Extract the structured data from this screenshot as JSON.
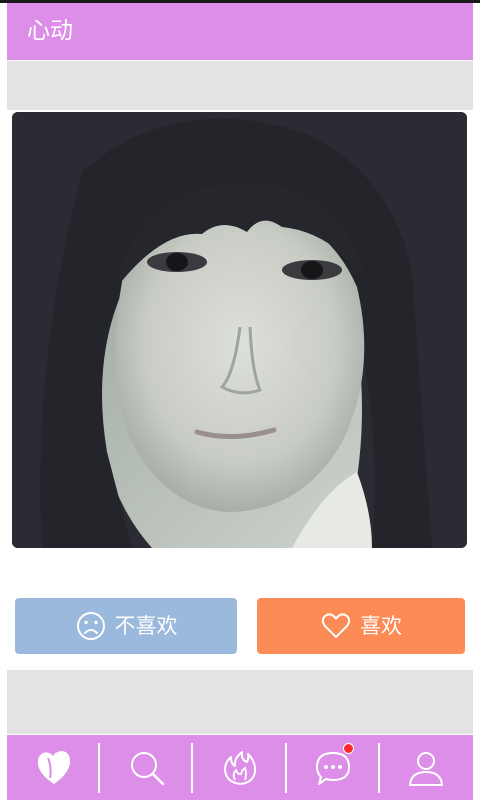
{
  "header": {
    "title": "心动"
  },
  "actions": {
    "dislike_label": "不喜欢",
    "like_label": "喜欢"
  },
  "tabbar": {
    "tabs": [
      {
        "icon": "heart-filled-icon",
        "active": true
      },
      {
        "icon": "search-icon",
        "active": false
      },
      {
        "icon": "flame-icon",
        "active": false
      },
      {
        "icon": "chat-bubble-icon",
        "active": false,
        "badge": true
      },
      {
        "icon": "person-icon",
        "active": false
      }
    ]
  },
  "colors": {
    "accent": "#dc8ee9",
    "dislike": "#9ab9dc",
    "like": "#fc8b56",
    "band": "#e3e3e3",
    "badge": "#ff2a2a"
  }
}
